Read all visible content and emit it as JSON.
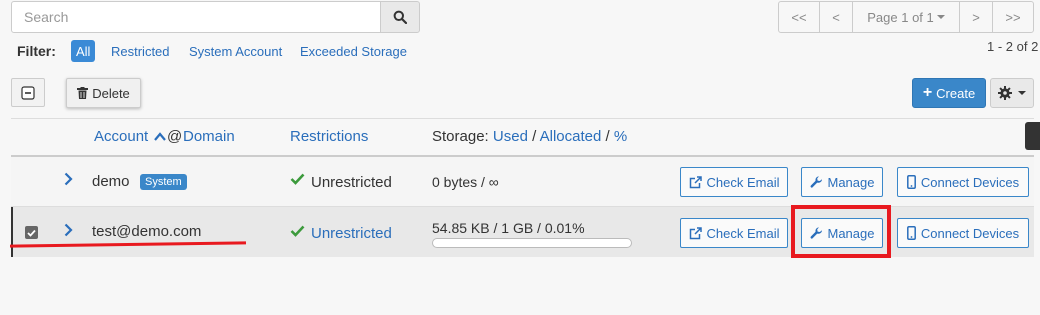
{
  "search": {
    "placeholder": "Search"
  },
  "pagination": {
    "first": "<<",
    "prev": "<",
    "page_label": "Page 1 of 1",
    "next": ">",
    "last": ">>"
  },
  "filter": {
    "label": "Filter:",
    "options": [
      "All",
      "Restricted",
      "System Account",
      "Exceeded Storage"
    ],
    "active": "All"
  },
  "count_text": "1 - 2 of 2",
  "toolbar": {
    "delete_label": "Delete",
    "create_label": "Create"
  },
  "table": {
    "headers": {
      "account": "Account",
      "at": "@",
      "domain": "Domain",
      "restrictions": "Restrictions",
      "storage_prefix": "Storage:",
      "used": "Used",
      "sep": "/",
      "allocated": "Allocated",
      "pct": "%"
    },
    "rows": [
      {
        "account": "demo",
        "badge": "System",
        "restriction": "Unrestricted",
        "storage": "0 bytes / ∞",
        "checked": false
      },
      {
        "account": "test@demo.com",
        "restriction": "Unrestricted",
        "storage": "54.85 KB / 1 GB / 0.01%",
        "usage_fraction": 0.0001,
        "checked": true
      }
    ],
    "actions": {
      "check_email": "Check Email",
      "manage": "Manage",
      "connect_devices": "Connect Devices"
    }
  },
  "colors": {
    "link": "#2a6ebb",
    "primary": "#3a87c9",
    "success": "#3c9a3c",
    "annotation_red": "#e8191f"
  }
}
